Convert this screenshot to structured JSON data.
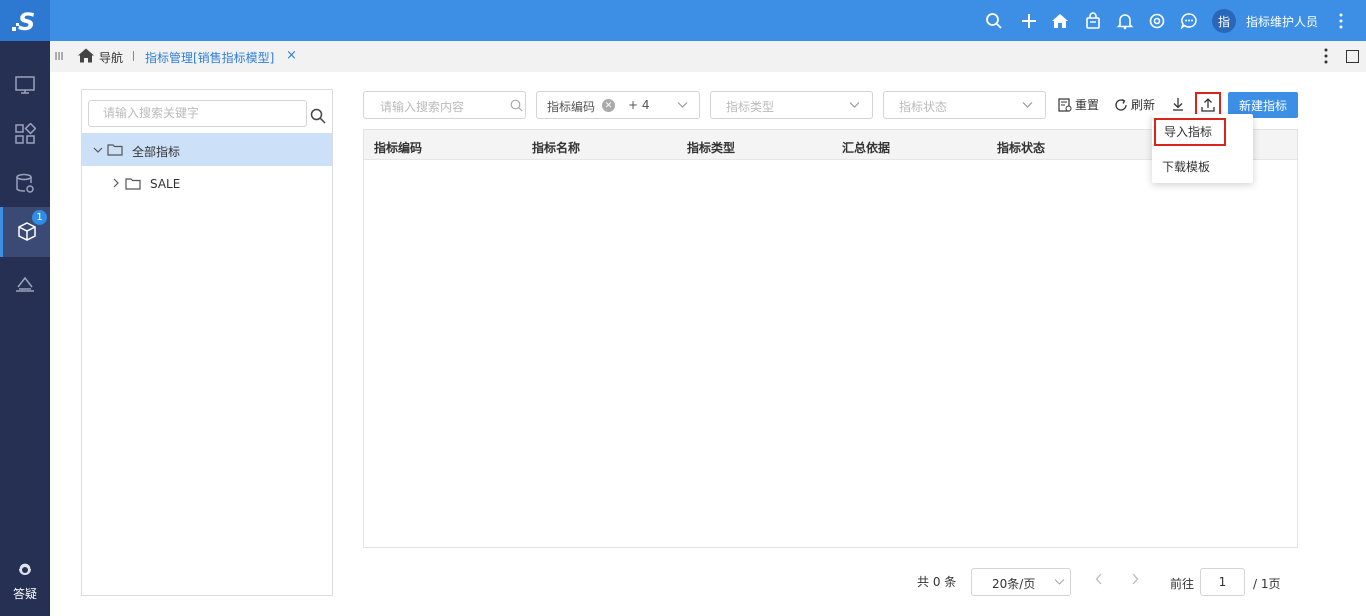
{
  "app": {
    "logo_letter": "S"
  },
  "user": {
    "avatar_char": "指",
    "name": "指标维护人员"
  },
  "sidebar": {
    "badge_count": "1",
    "help_label": "答疑"
  },
  "tabs": {
    "nav_label": "导航",
    "active_tab": "指标管理[销售指标模型]",
    "close_glyph": "×"
  },
  "tree": {
    "search_placeholder": "请输入搜索关键字",
    "root_label": "全部指标",
    "child_label": "SALE"
  },
  "toolbar": {
    "search_placeholder": "请输入搜索内容",
    "code_filter_tag": "指标编码",
    "code_filter_more": "+ 4",
    "type_placeholder": "指标类型",
    "status_placeholder": "指标状态",
    "reset_label": "重置",
    "refresh_label": "刷新",
    "new_button_label": "新建指标"
  },
  "upload_menu": {
    "import_label": "导入指标",
    "template_label": "下载模板"
  },
  "table": {
    "columns": [
      "指标编码",
      "指标名称",
      "指标类型",
      "汇总依据",
      "指标状态"
    ]
  },
  "pagination": {
    "total_text": "共 0 条",
    "page_size": "20条/页",
    "goto_label": "前往",
    "current_page": "1",
    "total_pages": "/ 1页"
  }
}
